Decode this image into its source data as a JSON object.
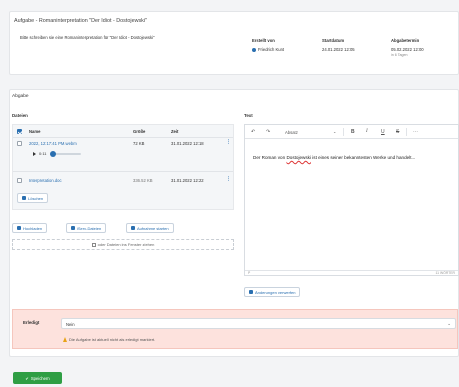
{
  "task": {
    "title": "Aufgabe - Romaninterpretation \"Der Idiot - Dostojewski\"",
    "description": "Bitte schreiben sie eine Romaninterpretation für \"Der Idiot - Dostojewski\"",
    "created_by_label": "Erstellt von",
    "created_by_value": "Friedrich Kunt",
    "start_label": "Startdatum",
    "start_value": "24.01.2022 12:05",
    "due_label": "Abgabetermin",
    "due_value": "05.02.2022 12:00",
    "due_note": "in 6 Tagen"
  },
  "submission": {
    "heading": "Abgabe",
    "files_heading": "Dateien",
    "text_heading": "Text",
    "columns": {
      "name": "Name",
      "size": "Größe",
      "time": "Zeit"
    },
    "files": [
      {
        "name": "2022, 12:17:41 PM.webm",
        "size": "72 KB",
        "time": "31.01.2022 12:18"
      },
      {
        "name": "Interpretation.doc",
        "size": "336.52 KB",
        "time": "31.01.2022 12:22"
      }
    ],
    "audio_time": "0:11",
    "audio_progress": 0,
    "delete_label": "Löschen",
    "upload_label": "Hochladen",
    "icloud_label": "iServ-Dateien",
    "record_label": "Aufnahme starten",
    "dropzone_text": "oder Dateien ins Fenster ziehen",
    "editor_style": "Absatz",
    "editor_text_before": "Der Roman von ",
    "editor_text_spell": "Dostojewski",
    "editor_text_after": " ist eines seiner bekanntesten Werke und handelt...",
    "editor_footer_left": "P",
    "editor_footer_right": "11 WÖRTER",
    "discard_label": "Änderungen verwerfen"
  },
  "status": {
    "label": "Erledigt",
    "selected": "Nein",
    "warning": "Die Aufgabe ist aktuell nicht als erledigt markiert."
  },
  "save_label": "Speichern",
  "colors": {
    "accent": "#2a6fb0",
    "success": "#2f9e44",
    "warning_bg": "#fde2dd"
  }
}
